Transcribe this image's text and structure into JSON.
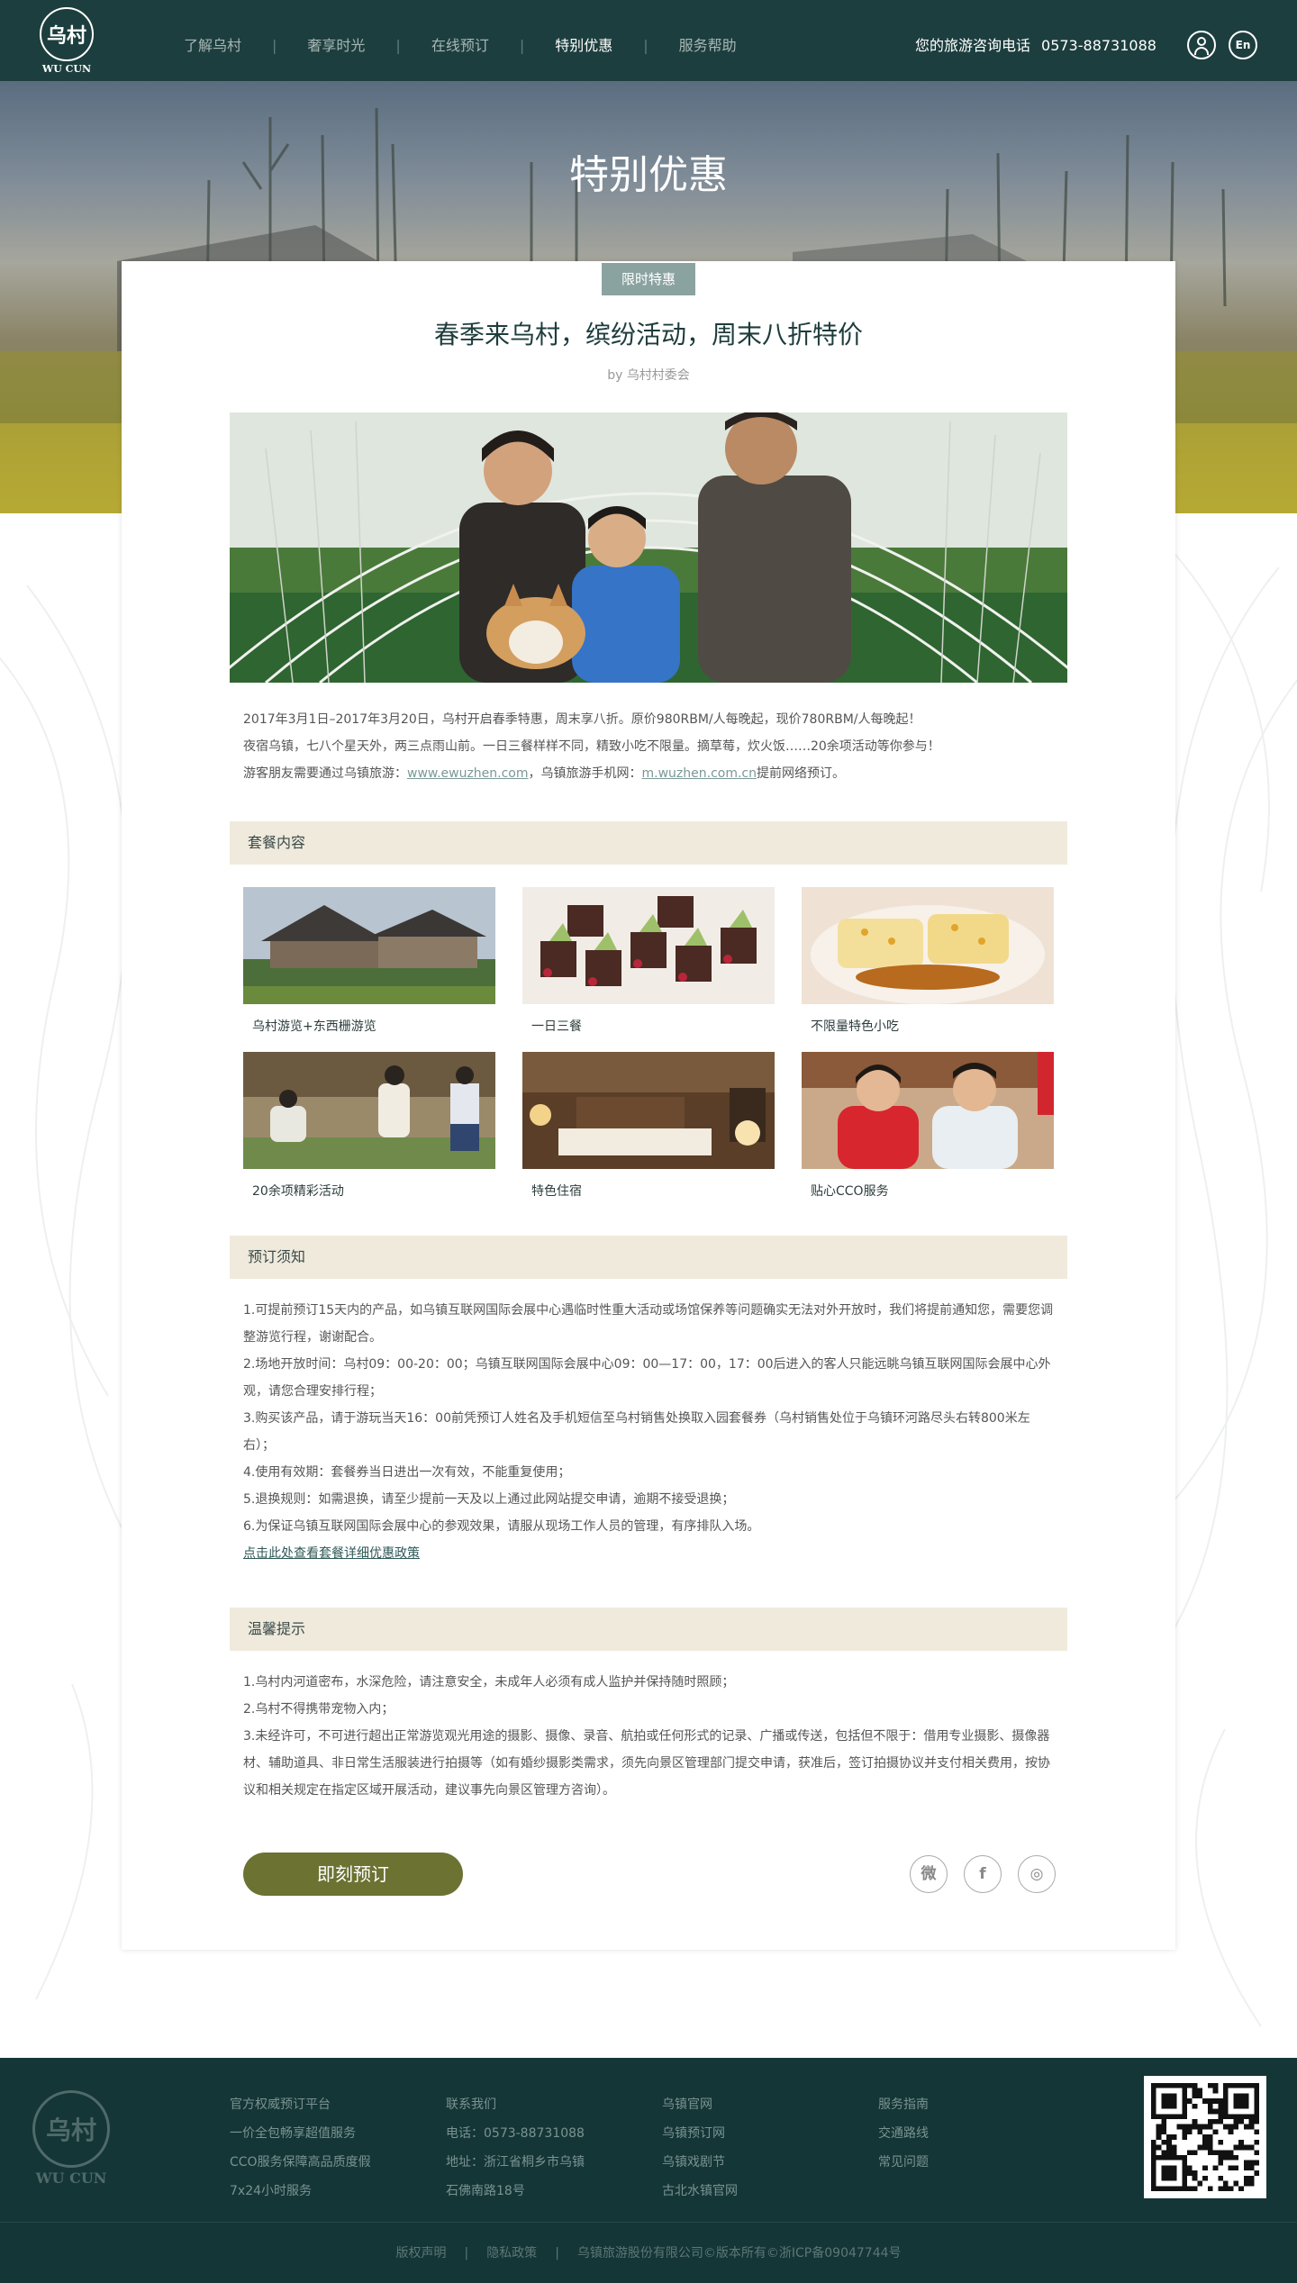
{
  "header": {
    "logo_text": "乌村",
    "logo_subtext": "WU CUN",
    "nav": [
      {
        "label": "了解乌村",
        "active": false
      },
      {
        "label": "奢享时光",
        "active": false
      },
      {
        "label": "在线预订",
        "active": false
      },
      {
        "label": "特别优惠",
        "active": true
      },
      {
        "label": "服务帮助",
        "active": false
      }
    ],
    "hotline_label": "您的旅游咨询电话",
    "hotline_number": "0573-88731088",
    "user_icon": "user-icon",
    "lang_label": "En"
  },
  "hero": {
    "title": "特别优惠"
  },
  "article": {
    "badge": "限时特惠",
    "title": "春季来乌村，缤纷活动，周末八折特价",
    "byline_prefix": "by",
    "byline_author": "乌村村委会",
    "intro": {
      "line1": "2017年3月1日–2017年3月20日，乌村开启春季特惠，周末享八折。原价980RBM/人每晚起，现价780RBM/人每晚起！",
      "line2": "夜宿乌镇，七八个星天外，两三点雨山前。一日三餐样样不同，精致小吃不限量。摘草莓，炊火饭……20余项活动等你参与！",
      "line3_prefix": "游客朋友需要通过乌镇旅游：",
      "link1": "www.ewuzhen.com",
      "line3_mid": "，乌镇旅游手机网：",
      "link2": "m.wuzhen.com.cn",
      "line3_suffix": "提前网络预订。"
    }
  },
  "package": {
    "heading": "套餐内容",
    "items": [
      {
        "label": "乌村游览+东西栅游览"
      },
      {
        "label": "一日三餐"
      },
      {
        "label": "不限量特色小吃"
      },
      {
        "label": "20余项精彩活动"
      },
      {
        "label": "特色住宿"
      },
      {
        "label": "贴心CCO服务"
      }
    ]
  },
  "booking_notes": {
    "heading": "预订须知",
    "items": [
      "1.可提前预订15天内的产品，如乌镇互联网国际会展中心遇临时性重大活动或场馆保养等问题确实无法对外开放时，我们将提前通知您，需要您调",
      "整游览行程，谢谢配合。",
      "2.场地开放时间：乌村09：00-20：00；乌镇互联网国际会展中心09：00—17：00，17：00后进入的客人只能远眺乌镇互联网国际会展中心外",
      "观，请您合理安排行程；",
      "3.购买该产品，请于游玩当天16：00前凭预订人姓名及手机短信至乌村销售处换取入园套餐券（乌村销售处位于乌镇环河路尽头右转800米左",
      "右）；",
      "4.使用有效期：套餐券当日进出一次有效，不能重复使用；",
      "5.退换规则：如需退换，请至少提前一天及以上通过此网站提交申请，逾期不接受退换；",
      "6.为保证乌镇互联网国际会展中心的参观效果，请服从现场工作人员的管理，有序排队入场。"
    ],
    "link": "点击此处查看套餐详细优惠政策"
  },
  "tips": {
    "heading": "温馨提示",
    "items": [
      "1.乌村内河道密布，水深危险，请注意安全，未成年人必须有成人监护并保持随时照顾；",
      "2.乌村不得携带宠物入内；",
      "3.未经许可，不可进行超出正常游览观光用途的摄影、摄像、录音、航拍或任何形式的记录、广播或传送，包括但不限于：借用专业摄影、摄像器",
      "材、辅助道具、非日常生活服装进行拍摄等（如有婚纱摄影类需求，须先向景区管理部门提交申请，获准后，签订拍摄协议并支付相关费用，按协",
      "议和相关规定在指定区域开展活动，建议事先向景区管理方咨询）。"
    ]
  },
  "actions": {
    "book_label": "即刻预订",
    "share": [
      {
        "icon": "weibo-icon",
        "glyph": "微"
      },
      {
        "icon": "facebook-icon",
        "glyph": "f"
      },
      {
        "icon": "wechat-icon",
        "glyph": "◎"
      }
    ]
  },
  "footer": {
    "logo_text": "乌村",
    "logo_subtext": "WU CUN",
    "col1": [
      "官方权威预订平台",
      "一价全包畅享超值服务",
      "CCO服务保障高品质度假",
      "7x24小时服务"
    ],
    "col2": [
      "联系我们",
      "电话：0573-88731088",
      "地址：浙江省桐乡市乌镇",
      "石佛南路18号"
    ],
    "col3": [
      "乌镇官网",
      "乌镇预订网",
      "乌镇戏剧节",
      "古北水镇官网"
    ],
    "col4": [
      "服务指南",
      "交通路线",
      "常见问题"
    ],
    "copyright": [
      "版权声明",
      "隐私政策",
      "乌镇旅游股份有限公司©版本所有©浙ICP备09047744号"
    ]
  },
  "colors": {
    "header_bg": "#1d3e3e",
    "section_bg": "#efeadc",
    "button": "#6c7232",
    "badge": "#8aa3a0",
    "footer_bg": "#143636"
  }
}
